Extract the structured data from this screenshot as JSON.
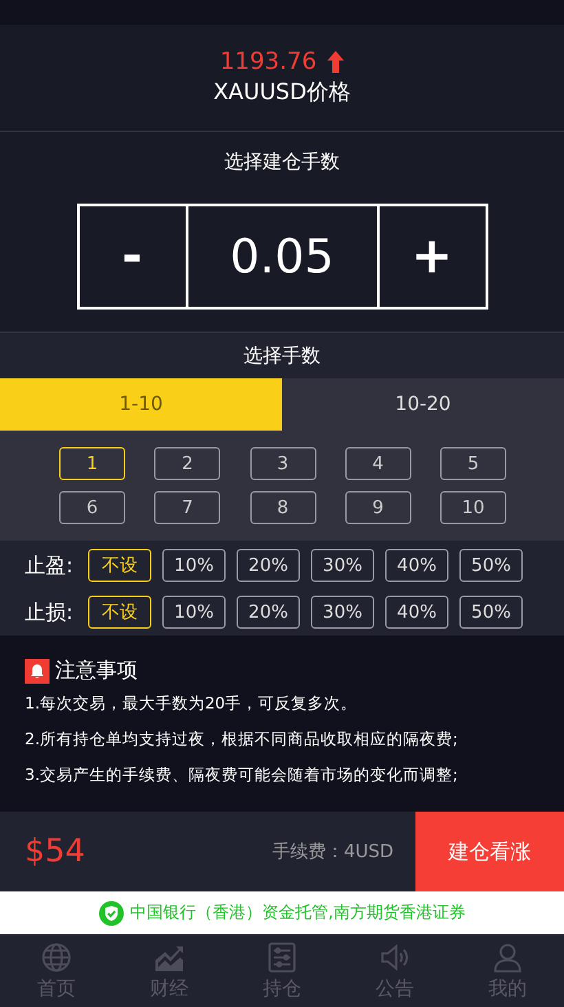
{
  "price": {
    "value": "1193.76",
    "kind": "up"
  },
  "symbol_title": "XAUUSD价格",
  "lot_title": "选择建仓手数",
  "stepper": {
    "minus": "-",
    "value": "0.05",
    "plus": "+"
  },
  "lot_select_title": "选择手数",
  "tabs": [
    {
      "label": "1-10",
      "selected": true
    },
    {
      "label": "10-20",
      "selected": false
    }
  ],
  "lots": [
    {
      "label": "1",
      "selected": true
    },
    {
      "label": "2",
      "selected": false
    },
    {
      "label": "3",
      "selected": false
    },
    {
      "label": "4",
      "selected": false
    },
    {
      "label": "5",
      "selected": false
    },
    {
      "label": "6",
      "selected": false
    },
    {
      "label": "7",
      "selected": false
    },
    {
      "label": "8",
      "selected": false
    },
    {
      "label": "9",
      "selected": false
    },
    {
      "label": "10",
      "selected": false
    }
  ],
  "take_profit": {
    "label": "止盈:",
    "options": [
      {
        "label": "不设",
        "selected": true
      },
      {
        "label": "10%",
        "selected": false
      },
      {
        "label": "20%",
        "selected": false
      },
      {
        "label": "30%",
        "selected": false
      },
      {
        "label": "40%",
        "selected": false
      },
      {
        "label": "50%",
        "selected": false
      }
    ]
  },
  "stop_loss": {
    "label": "止损:",
    "options": [
      {
        "label": "不设",
        "selected": true
      },
      {
        "label": "10%",
        "selected": false
      },
      {
        "label": "20%",
        "selected": false
      },
      {
        "label": "30%",
        "selected": false
      },
      {
        "label": "40%",
        "selected": false
      },
      {
        "label": "50%",
        "selected": false
      }
    ]
  },
  "notes": {
    "title": "注意事项",
    "items": [
      "1.每次交易，最大手数为20手，可反复多次。",
      "2.所有持仓单均支持过夜，根据不同商品收取相应的隔夜费;",
      "3.交易产生的手续费、隔夜费可能会随着市场的变化而调整;"
    ]
  },
  "footer": {
    "amount": "$54",
    "fee": "手续费：4USD",
    "button": "建仓看涨"
  },
  "banner": "中国银行（香港）资金托管,南方期货香港证券",
  "nav": [
    {
      "label": "首页",
      "kind": "globe"
    },
    {
      "label": "财经",
      "kind": "chart"
    },
    {
      "label": "持仓",
      "kind": "list"
    },
    {
      "label": "公告",
      "kind": "speaker"
    },
    {
      "label": "我的",
      "kind": "user"
    }
  ]
}
